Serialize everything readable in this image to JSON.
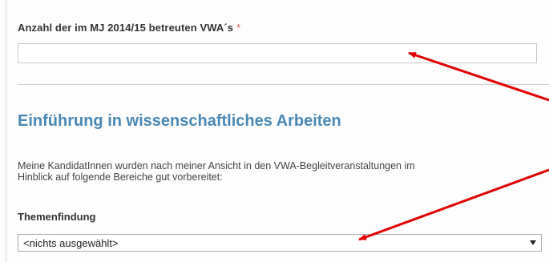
{
  "form": {
    "vwa_count": {
      "label": "Anzahl der im MJ 2014/15 betreuten VWA´s",
      "required_marker": "*",
      "value": ""
    },
    "section": {
      "title": "Einführung in wissenschaftliches Arbeiten",
      "intro_line1": "Meine KandidatInnen wurden nach meiner Ansicht in den VWA-Begleitveranstaltungen im",
      "intro_line2": "Hinblick auf folgende Bereiche gut vorbereitet:"
    },
    "topic_finding": {
      "label": "Themenfindung",
      "selected": "<nichts ausgewählt>"
    }
  },
  "colors": {
    "section_title": "#4a88b6",
    "required": "#d9534f",
    "annotation_arrow": "#e00000"
  },
  "annotations": {
    "arrow_icon": "red-arrow-icon"
  }
}
